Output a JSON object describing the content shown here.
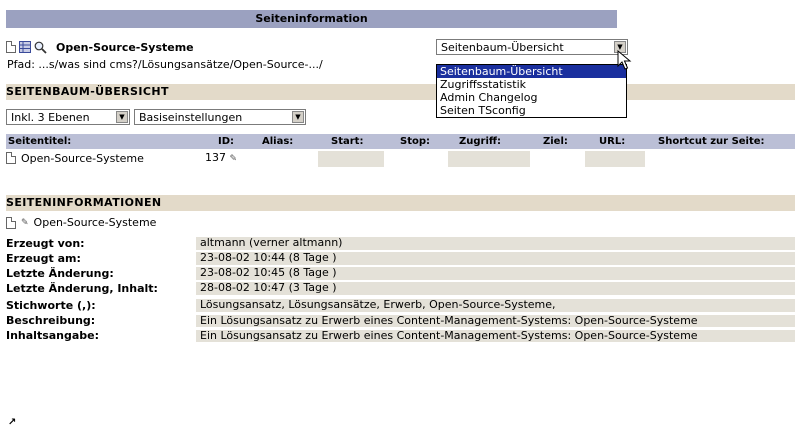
{
  "header": {
    "title": "Seiteninformation"
  },
  "page": {
    "title": "Open-Source-Systeme",
    "path": "Pfad: ...s/was sind cms?/Lösungsansätze/Open-Source-.../"
  },
  "view_select": {
    "value": "Seitenbaum-Übersicht",
    "options": [
      "Seitenbaum-Übersicht",
      "Zugriffsstatistik",
      "Admin Changelog",
      "Seiten TSconfig"
    ]
  },
  "tree_section": {
    "heading": "SEITENBAUM-ÜBERSICHT",
    "depth_select": "Inkl. 3 Ebenen",
    "settings_select": "Basiseinstellungen",
    "columns": [
      "Seitentitel:",
      "ID:",
      "Alias:",
      "Start:",
      "Stop:",
      "Zugriff:",
      "Ziel:",
      "URL:",
      "Shortcut zur Seite:"
    ],
    "row": {
      "title": "Open-Source-Systeme",
      "id": "137"
    }
  },
  "info_section": {
    "heading": "SEITENINFORMATIONEN",
    "page_title": "Open-Source-Systeme",
    "rows": [
      {
        "key": "Erzeugt von:",
        "value": "altmann (verner altmann)"
      },
      {
        "key": "Erzeugt am:",
        "value": "23-08-02 10:44 (8 Tage )"
      },
      {
        "key": "Letzte Änderung:",
        "value": "23-08-02 10:45 (8 Tage )"
      },
      {
        "key": "Letzte Änderung, Inhalt:",
        "value": "28-08-02 10:47 (3 Tage )"
      },
      {
        "key": "Stichworte (,):",
        "value": "Lösungsansatz, Lösungsansätze, Erwerb, Open-Source-Systeme,"
      },
      {
        "key": "Beschreibung:",
        "value": "Ein Lösungsansatz zu Erwerb eines Content-Management-Systems: Open-Source-Systeme"
      },
      {
        "key": "Inhaltsangabe:",
        "value": "Ein Lösungsansatz zu Erwerb eines Content-Management-Systems: Open-Source-Systeme"
      }
    ]
  }
}
